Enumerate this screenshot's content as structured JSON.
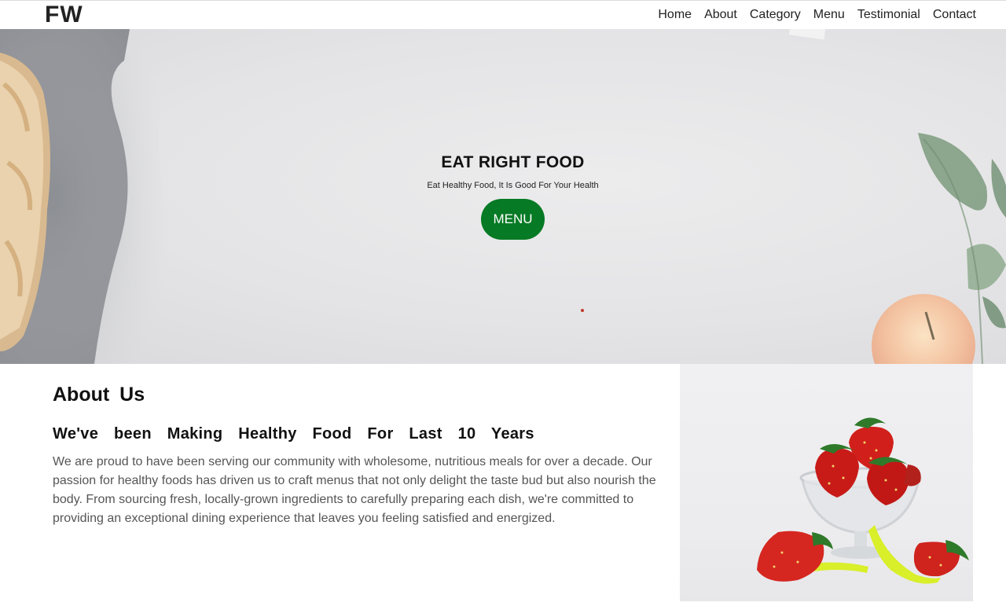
{
  "brand": {
    "logo": "FW"
  },
  "nav": {
    "items": [
      "Home",
      "About",
      "Category",
      "Menu",
      "Testimonial",
      "Contact"
    ]
  },
  "hero": {
    "title": "EAT RIGHT FOOD",
    "subtitle": "Eat Healthy Food, It Is Good For Your Health",
    "button_label": "MENU",
    "accent_color": "#067a24"
  },
  "about": {
    "title": "About  Us",
    "heading": "We've been Making Healthy Food For Last 10 Years",
    "body": "We are proud to have been serving our community with wholesome, nutritious meals for over a decade. Our passion for healthy foods has driven us to craft menus that not only delight the taste bud but also nourish the body. From sourcing fresh, locally-grown ingredients to carefully preparing each dish, we're committed to providing an exceptional dining experience that leaves you feeling satisfied and energized.",
    "image_icon": "strawberries-bowl-image"
  }
}
